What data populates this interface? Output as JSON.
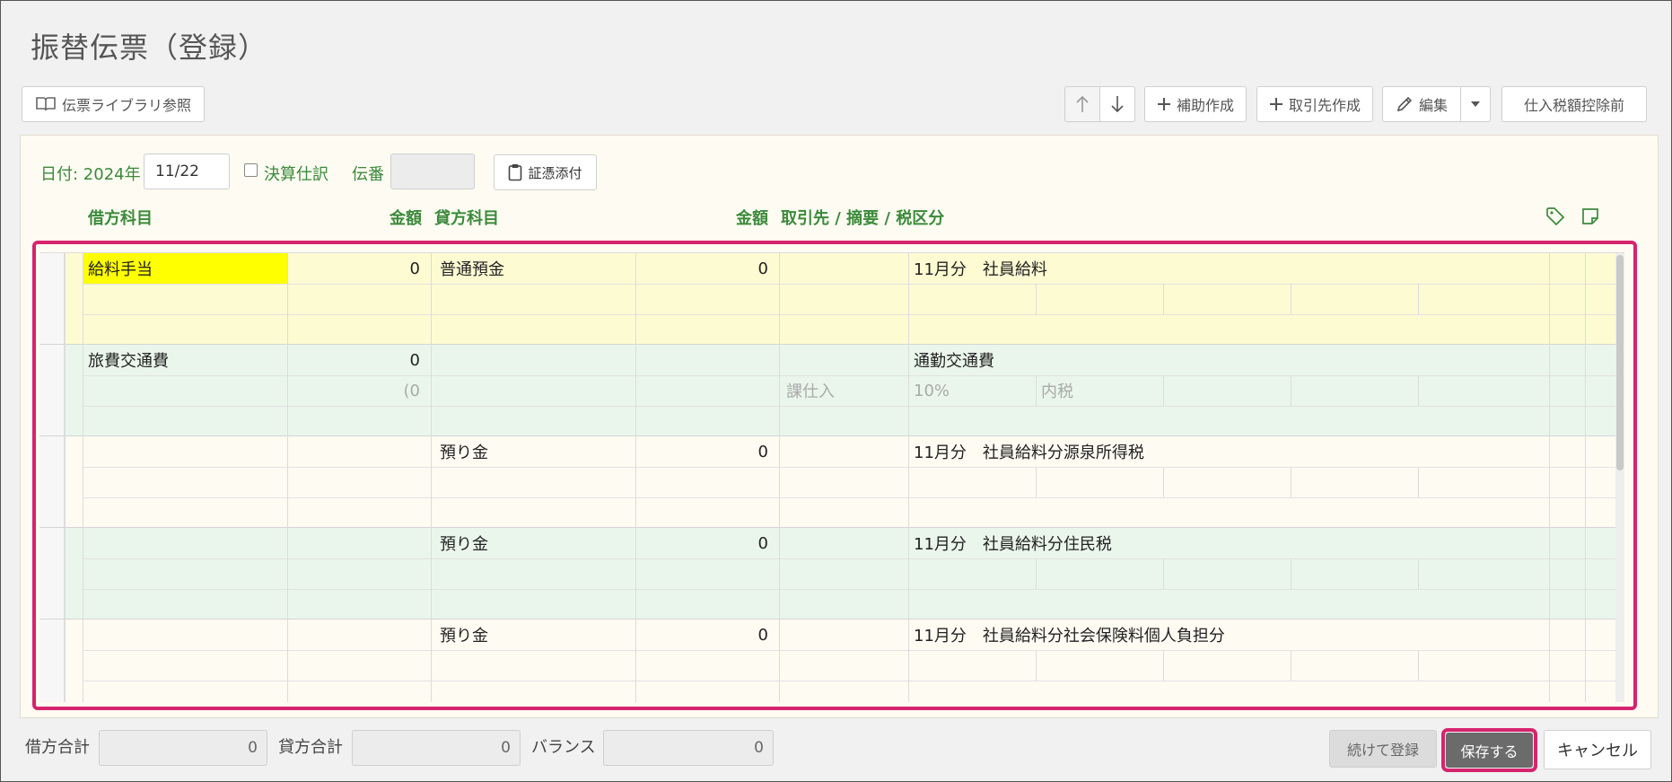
{
  "page_title": "振替伝票（登録）",
  "toolbar": {
    "library_button": "伝票ライブラリ参照",
    "sub_button": "補助作成",
    "partner_button": "取引先作成",
    "edit_button": "編集",
    "tax_button": "仕入税額控除前"
  },
  "form": {
    "date_label": "日付: 2024年",
    "date_value": "11/22",
    "settlement_label": "決算仕訳",
    "slip_label": "伝番",
    "slip_value": "",
    "attach_button": "証憑添付"
  },
  "columns": {
    "debit_account": "借方科目",
    "debit_amount": "金額",
    "credit_account": "貸方科目",
    "credit_amount": "金額",
    "memo": "取引先 / 摘要 / 税区分"
  },
  "rows": [
    {
      "debit_account": "給料手当",
      "debit_amount": "0",
      "credit_account": "普通預金",
      "credit_amount": "0",
      "memo": "11月分　社員給料",
      "tax": "",
      "tax_rate": "",
      "tax_type": "",
      "debit_sub": ""
    },
    {
      "debit_account": "旅費交通費",
      "debit_amount": "0",
      "credit_account": "",
      "credit_amount": "",
      "memo": "通勤交通費",
      "tax": "課仕入",
      "tax_rate": "10%",
      "tax_type": "内税",
      "debit_sub": "(0"
    },
    {
      "debit_account": "",
      "debit_amount": "",
      "credit_account": "預り金",
      "credit_amount": "0",
      "memo": "11月分　社員給料分源泉所得税",
      "tax": "",
      "tax_rate": "",
      "tax_type": "",
      "debit_sub": ""
    },
    {
      "debit_account": "",
      "debit_amount": "",
      "credit_account": "預り金",
      "credit_amount": "0",
      "memo": "11月分　社員給料分住民税",
      "tax": "",
      "tax_rate": "",
      "tax_type": "",
      "debit_sub": ""
    },
    {
      "debit_account": "",
      "debit_amount": "",
      "credit_account": "預り金",
      "credit_amount": "0",
      "memo": "11月分　社員給料分社会保険料個人負担分",
      "tax": "",
      "tax_rate": "",
      "tax_type": "",
      "debit_sub": ""
    }
  ],
  "footer": {
    "debit_total_label": "借方合計",
    "debit_total": "0",
    "credit_total_label": "貸方合計",
    "credit_total": "0",
    "balance_label": "バランス",
    "balance": "0",
    "continue_button": "続けて登録",
    "save_button": "保存する",
    "cancel_button": "キャンセル"
  },
  "colors": {
    "accent_green": "#3b8a3b",
    "highlight": "#d6246e",
    "row_yellow": "#fdfbd2",
    "row_green": "#eaf6ec",
    "row_cream": "#fefbf2",
    "cell_yellow": "#ffff00"
  },
  "icons": {
    "library": "book-icon",
    "up": "arrow-up-icon",
    "down": "arrow-down-icon",
    "plus": "plus-icon",
    "edit": "pencil-icon",
    "caret": "caret-down-icon",
    "attach": "clipboard-icon",
    "tag": "tag-icon",
    "note": "note-icon"
  }
}
